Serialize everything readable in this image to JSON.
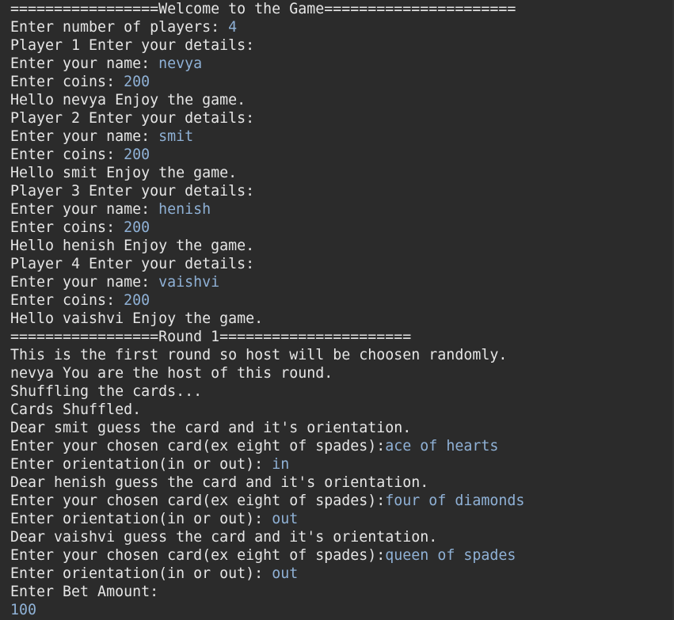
{
  "console": {
    "lines": [
      {
        "text": "=================Welcome to the Game======================",
        "input": ""
      },
      {
        "text": "Enter number of players: ",
        "input": "4"
      },
      {
        "text": "Player 1 Enter your details:",
        "input": ""
      },
      {
        "text": "Enter your name: ",
        "input": "nevya"
      },
      {
        "text": "Enter coins: ",
        "input": "200"
      },
      {
        "text": "Hello nevya Enjoy the game.",
        "input": ""
      },
      {
        "text": "Player 2 Enter your details:",
        "input": ""
      },
      {
        "text": "Enter your name: ",
        "input": "smit"
      },
      {
        "text": "Enter coins: ",
        "input": "200"
      },
      {
        "text": "Hello smit Enjoy the game.",
        "input": ""
      },
      {
        "text": "Player 3 Enter your details:",
        "input": ""
      },
      {
        "text": "Enter your name: ",
        "input": "henish"
      },
      {
        "text": "Enter coins: ",
        "input": "200"
      },
      {
        "text": "Hello henish Enjoy the game.",
        "input": ""
      },
      {
        "text": "Player 4 Enter your details:",
        "input": ""
      },
      {
        "text": "Enter your name: ",
        "input": "vaishvi"
      },
      {
        "text": "Enter coins: ",
        "input": "200"
      },
      {
        "text": "Hello vaishvi Enjoy the game.",
        "input": ""
      },
      {
        "text": "=================Round 1======================",
        "input": ""
      },
      {
        "text": "This is the first round so host will be choosen randomly.",
        "input": ""
      },
      {
        "text": "nevya You are the host of this round.",
        "input": ""
      },
      {
        "text": "Shuffling the cards...",
        "input": ""
      },
      {
        "text": "Cards Shuffled.",
        "input": ""
      },
      {
        "text": "Dear smit guess the card and it's orientation.",
        "input": ""
      },
      {
        "text": "Enter your chosen card(ex eight of spades):",
        "input": "ace of hearts"
      },
      {
        "text": "Enter orientation(in or out): ",
        "input": "in"
      },
      {
        "text": "Dear henish guess the card and it's orientation.",
        "input": ""
      },
      {
        "text": "Enter your chosen card(ex eight of spades):",
        "input": "four of diamonds"
      },
      {
        "text": "Enter orientation(in or out): ",
        "input": "out"
      },
      {
        "text": "Dear vaishvi guess the card and it's orientation.",
        "input": ""
      },
      {
        "text": "Enter your chosen card(ex eight of spades):",
        "input": "queen of spades"
      },
      {
        "text": "Enter orientation(in or out): ",
        "input": "out"
      },
      {
        "text": "Enter Bet Amount:",
        "input": ""
      },
      {
        "text": "",
        "input": "100"
      }
    ]
  },
  "colors": {
    "background": "#2b2b2b",
    "output_text": "#e6e6e6",
    "user_input": "#8fb1d6"
  }
}
